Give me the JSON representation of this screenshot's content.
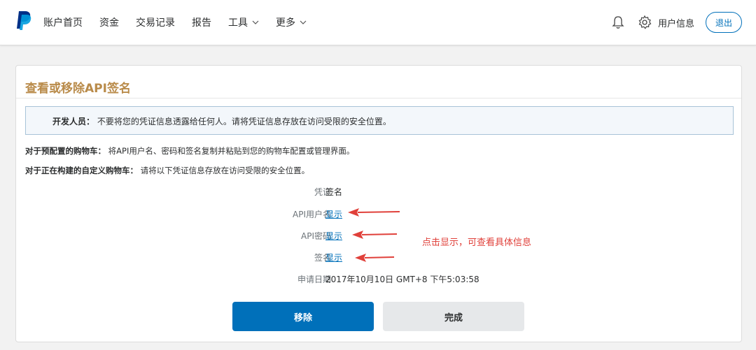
{
  "nav": {
    "items": [
      {
        "label": "账户首页",
        "has_dropdown": false
      },
      {
        "label": "资金",
        "has_dropdown": false
      },
      {
        "label": "交易记录",
        "has_dropdown": false
      },
      {
        "label": "报告",
        "has_dropdown": false
      },
      {
        "label": "工具",
        "has_dropdown": true
      },
      {
        "label": "更多",
        "has_dropdown": true
      }
    ],
    "user_info_label": "用户信息",
    "logout_label": "退出",
    "icons": [
      "paypal-logo",
      "bell-icon",
      "gear-icon"
    ]
  },
  "page": {
    "title": "查看或移除API签名",
    "notice_label": "开发人员：",
    "notice_text": "不要将您的凭证信息透露给任何人。请将凭证信息存放在访问受限的安全位置。",
    "para1_label": "对于预配置的购物车：",
    "para1_text": "将API用户名、密码和签名复制并粘贴到您的购物车配置或管理界面。",
    "para2_label": "对于正在构建的自定义购物车：",
    "para2_text": "请将以下凭证信息存放在访问受限的安全位置。"
  },
  "credentials": {
    "rows": [
      {
        "label": "凭证",
        "value": "签名"
      },
      {
        "label": "API用户名",
        "value": "显示"
      },
      {
        "label": "API密码",
        "value": "显示"
      },
      {
        "label": "签名",
        "value": "显示"
      },
      {
        "label": "申请日期",
        "value": "2017年10月10日 GMT+8 下午5:03:58"
      }
    ]
  },
  "annotation": "点击显示，可查看具体信息",
  "buttons": {
    "remove": "移除",
    "done": "完成"
  },
  "colors": {
    "brand_blue": "#0070ba",
    "title_gold": "#b98b4a",
    "annotation_red": "#e0403a"
  }
}
